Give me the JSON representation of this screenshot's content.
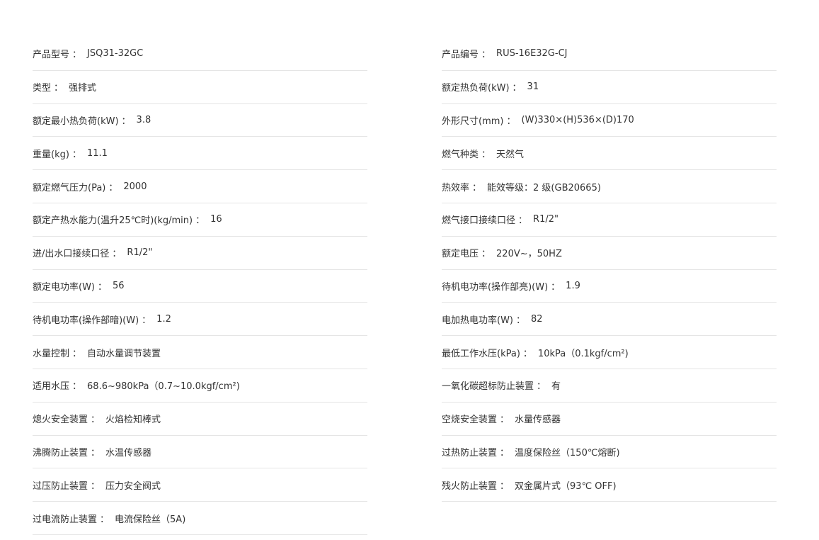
{
  "specs": {
    "left": [
      {
        "label": "产品型号",
        "value": "JSQ31-32GC"
      },
      {
        "label": "类型",
        "value": "强排式"
      },
      {
        "label": "额定最小热负荷(kW)",
        "value": "3.8"
      },
      {
        "label": "重量(kg)",
        "value": "11.1"
      },
      {
        "label": "额定燃气压力(Pa)",
        "value": "2000"
      },
      {
        "label": "额定产热水能力(温升25℃时)(kg/min)",
        "value": "16"
      },
      {
        "label": "进/出水口接续口径",
        "value": "R1/2\""
      },
      {
        "label": "额定电功率(W)",
        "value": "56"
      },
      {
        "label": "待机电功率(操作部暗)(W)",
        "value": "1.2"
      },
      {
        "label": "水量控制",
        "value": "自动水量调节装置"
      },
      {
        "label": "适用水压",
        "value": "68.6~980kPa（0.7~10.0kgf/cm²)"
      },
      {
        "label": "熄火安全装置",
        "value": "火焰检知棒式"
      },
      {
        "label": "沸腾防止装置",
        "value": "水温传感器"
      },
      {
        "label": "过压防止装置",
        "value": "压力安全阀式"
      },
      {
        "label": "过电流防止装置",
        "value": "电流保险丝（5A)"
      }
    ],
    "right": [
      {
        "label": "产品编号",
        "value": "RUS-16E32G-CJ"
      },
      {
        "label": "额定热负荷(kW)",
        "value": "31"
      },
      {
        "label": "外形尺寸(mm)",
        "value": "(W)330×(H)536×(D)170"
      },
      {
        "label": "燃气种类",
        "value": "天然气"
      },
      {
        "label": "热效率",
        "value": "能效等级：2 级(GB20665)"
      },
      {
        "label": "燃气接口接续口径",
        "value": "R1/2\""
      },
      {
        "label": "额定电压",
        "value": "220V~，50HZ"
      },
      {
        "label": "待机电功率(操作部亮)(W)",
        "value": "1.9"
      },
      {
        "label": "电加热电功率(W)",
        "value": "82"
      },
      {
        "label": "最低工作水压(kPa)",
        "value": "10kPa（0.1kgf/cm²)"
      },
      {
        "label": "一氧化碳超标防止装置",
        "value": "有"
      },
      {
        "label": "空烧安全装置",
        "value": "水量传感器"
      },
      {
        "label": "过热防止装置",
        "value": "温度保险丝（150℃熔断)"
      },
      {
        "label": "残火防止装置",
        "value": "双金属片式（93℃ OFF)"
      }
    ],
    "separator": "："
  }
}
